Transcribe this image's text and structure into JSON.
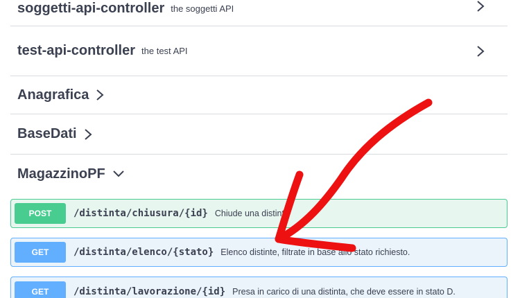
{
  "controllers": [
    {
      "name": "soggetti-api-controller",
      "description": "the soggetti API",
      "icon": "chevron-right-icon"
    },
    {
      "name": "test-api-controller",
      "description": "the test API",
      "icon": "chevron-right-icon"
    }
  ],
  "sections": [
    {
      "name": "Anagrafica",
      "state": "collapsed",
      "icon": "chevron-right-icon"
    },
    {
      "name": "BaseDati",
      "state": "collapsed",
      "icon": "chevron-right-icon"
    },
    {
      "name": "MagazzinoPF",
      "state": "expanded",
      "icon": "chevron-down-icon"
    }
  ],
  "operations": [
    {
      "method": "POST",
      "path": "/distinta/chiusura/{id}",
      "summary": "Chiude una distinta"
    },
    {
      "method": "GET",
      "path": "/distinta/elenco/{stato}",
      "summary": "Elenco distinte, filtrate in base allo stato richiesto."
    },
    {
      "method": "GET",
      "path": "/distinta/lavorazione/{id}",
      "summary": "Presa in carico di una distinta, che deve essere in stato D."
    }
  ],
  "colors": {
    "post": "#49cc90",
    "get": "#61affe",
    "text": "#3b4151",
    "annotation": "#ee1111"
  }
}
